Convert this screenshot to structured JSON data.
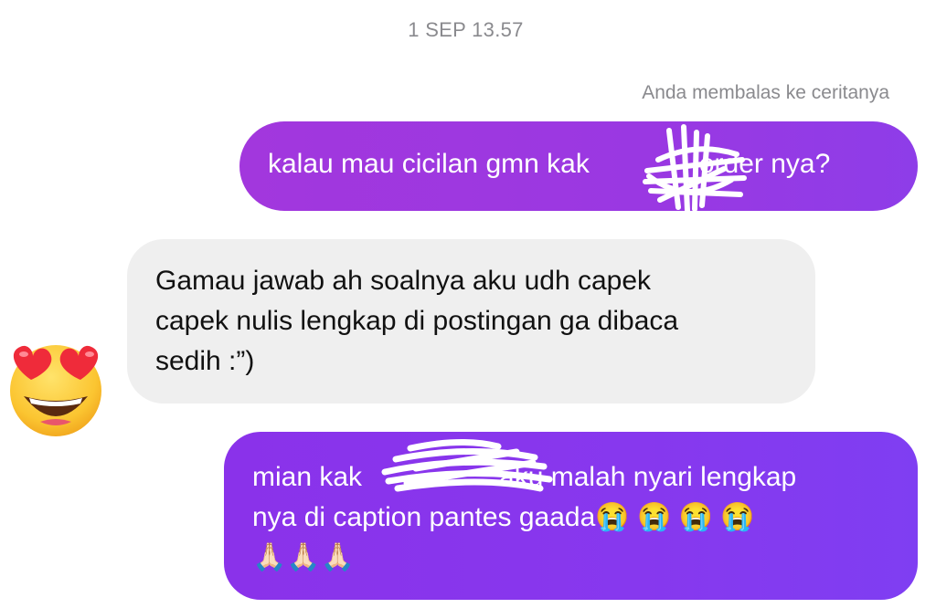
{
  "chat": {
    "timestamp": "1 SEP 13.57",
    "reply_note": "Anda membalas ke ceritanya",
    "messages": [
      {
        "direction": "outgoing",
        "text": "kalau mau cicilan gmn kak",
        "text_after": "order nya?"
      },
      {
        "direction": "incoming",
        "lines": [
          "Gamau jawab ah soalnya aku udh capek",
          "capek nulis lengkap di postingan ga dibaca",
          "sedih :”)"
        ],
        "reaction": "heart-eyes-emoji"
      },
      {
        "direction": "outgoing",
        "line1_start": "mian kak",
        "line1_end": "aku malah nyari lengkap",
        "line2": "nya di caption pantes gaada😭 😭 😭 😭",
        "line3": "🙏🏻🙏🏻🙏🏻"
      }
    ]
  },
  "colors": {
    "outgoing_bubble_top": "#a237dd",
    "outgoing_bubble_bottom": "#8738ee",
    "incoming_bubble": "#efefef",
    "meta_text": "#8a8a8e"
  }
}
